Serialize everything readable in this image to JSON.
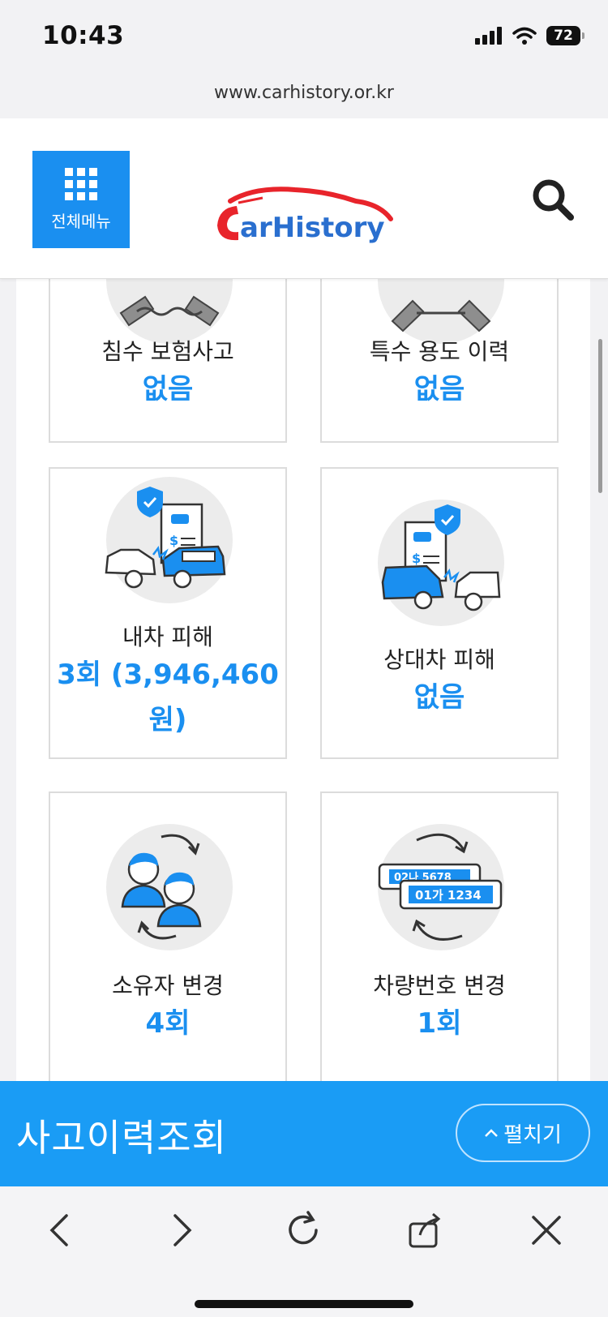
{
  "status": {
    "time": "10:43",
    "battery": "72"
  },
  "url": "www.carhistory.or.kr",
  "header": {
    "menu_label": "전체메뉴",
    "logo_text": "CarHistory"
  },
  "cards": [
    {
      "label": "침수 보험사고",
      "value": "없음",
      "icon": "flood-car-icon"
    },
    {
      "label": "특수 용도 이력",
      "value": "없음",
      "icon": "special-use-car-icon"
    },
    {
      "label": "내차 피해",
      "value": "3회 (3,946,460",
      "value2": "원)",
      "icon": "own-car-damage-icon"
    },
    {
      "label": "상대차 피해",
      "value": "없음",
      "icon": "other-car-damage-icon"
    },
    {
      "label": "소유자 변경",
      "value": "4회",
      "icon": "owner-change-icon"
    },
    {
      "label": "차량번호 변경",
      "value": "1회",
      "icon": "plate-change-icon",
      "plate_old": "02나 5678",
      "plate_new": "01가 1234"
    }
  ],
  "bottom": {
    "title": "사고이력조회",
    "expand_label": "펼치기"
  },
  "colors": {
    "accent": "#1a8ff0",
    "bar": "#1a9cf5",
    "logo_red": "#e8242b"
  }
}
